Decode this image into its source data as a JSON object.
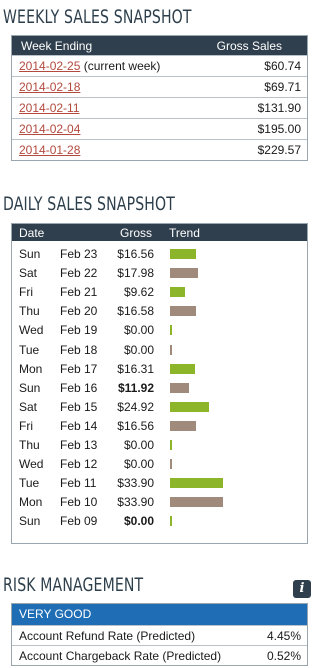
{
  "weekly": {
    "title": "WEEKLY SALES SNAPSHOT",
    "col_week": "Week Ending",
    "col_gross": "Gross Sales",
    "rows": [
      {
        "date": "2014-02-25",
        "note": "(current week)",
        "gross": "$60.74"
      },
      {
        "date": "2014-02-18",
        "note": "",
        "gross": "$69.71"
      },
      {
        "date": "2014-02-11",
        "note": "",
        "gross": "$131.90"
      },
      {
        "date": "2014-02-04",
        "note": "",
        "gross": "$195.00"
      },
      {
        "date": "2014-01-28",
        "note": "",
        "gross": "$229.57"
      }
    ]
  },
  "daily": {
    "title": "DAILY SALES SNAPSHOT",
    "col_date": "Date",
    "col_gross": "Gross",
    "col_trend": "Trend",
    "colors": {
      "up": "#8db52a",
      "down": "#a08a7b"
    },
    "rows": [
      {
        "day": "Sun",
        "date": "Feb 23",
        "gross": "$16.56",
        "value": 16.56,
        "trend": "up",
        "bold": false
      },
      {
        "day": "Sat",
        "date": "Feb 22",
        "gross": "$17.98",
        "value": 17.98,
        "trend": "down",
        "bold": false
      },
      {
        "day": "Fri",
        "date": "Feb 21",
        "gross": "$9.62",
        "value": 9.62,
        "trend": "up",
        "bold": false
      },
      {
        "day": "Thu",
        "date": "Feb 20",
        "gross": "$16.58",
        "value": 16.58,
        "trend": "down",
        "bold": false
      },
      {
        "day": "Wed",
        "date": "Feb 19",
        "gross": "$0.00",
        "value": 0,
        "trend": "up",
        "bold": false
      },
      {
        "day": "Tue",
        "date": "Feb 18",
        "gross": "$0.00",
        "value": 0,
        "trend": "down",
        "bold": false
      },
      {
        "day": "Mon",
        "date": "Feb 17",
        "gross": "$16.31",
        "value": 16.31,
        "trend": "up",
        "bold": false
      },
      {
        "day": "Sun",
        "date": "Feb 16",
        "gross": "$11.92",
        "value": 11.92,
        "trend": "down",
        "bold": true
      },
      {
        "day": "Sat",
        "date": "Feb 15",
        "gross": "$24.92",
        "value": 24.92,
        "trend": "up",
        "bold": false
      },
      {
        "day": "Fri",
        "date": "Feb 14",
        "gross": "$16.56",
        "value": 16.56,
        "trend": "down",
        "bold": false
      },
      {
        "day": "Thu",
        "date": "Feb 13",
        "gross": "$0.00",
        "value": 0,
        "trend": "up",
        "bold": false
      },
      {
        "day": "Wed",
        "date": "Feb 12",
        "gross": "$0.00",
        "value": 0,
        "trend": "down",
        "bold": false
      },
      {
        "day": "Tue",
        "date": "Feb 11",
        "gross": "$33.90",
        "value": 33.9,
        "trend": "up",
        "bold": false
      },
      {
        "day": "Mon",
        "date": "Feb 10",
        "gross": "$33.90",
        "value": 33.9,
        "trend": "down",
        "bold": false
      },
      {
        "day": "Sun",
        "date": "Feb 09",
        "gross": "$0.00",
        "value": 0,
        "trend": "up",
        "bold": true
      }
    ]
  },
  "risk": {
    "title": "RISK MANAGEMENT",
    "info_icon": "info-icon",
    "status": "VERY GOOD",
    "status_color": "#1e6db5",
    "rows": [
      {
        "label": "Account Refund Rate (Predicted)",
        "value": "4.45%"
      },
      {
        "label": "Account Chargeback Rate (Predicted)",
        "value": "0.52%"
      }
    ]
  }
}
